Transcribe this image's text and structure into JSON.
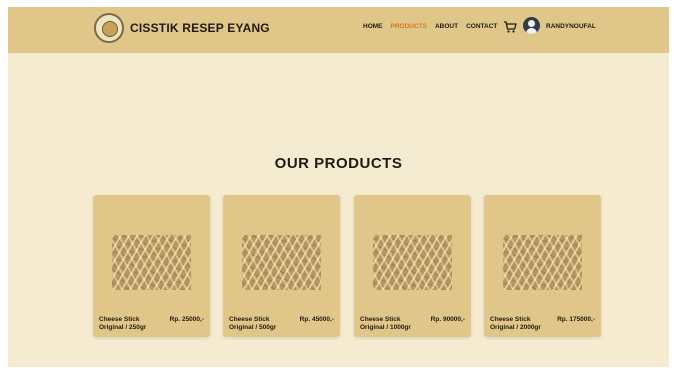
{
  "header": {
    "brand": "CISSTIK RESEP EYANG",
    "nav": [
      "HOME",
      "PRODUCTS",
      "ABOUT",
      "CONTACT"
    ],
    "active_nav": "PRODUCTS",
    "username": "RANDYNOUFAL",
    "icons": {
      "logo": "brand-logo",
      "cart": "cart-icon",
      "avatar": "user-avatar-icon"
    }
  },
  "main": {
    "title": "OUR PRODUCTS",
    "products": [
      {
        "name": "Cheese Stick\nOriginal / 250gr",
        "price": "Rp. 25000,-"
      },
      {
        "name": "Cheese Stick\nOriginal / 500gr",
        "price": "Rp. 45000,-"
      },
      {
        "name": "Cheese Stick\nOriginal / 1000gr",
        "price": "Rp. 90000,-"
      },
      {
        "name": "Cheese Stick\nOriginal / 2000gr",
        "price": "Rp. 175000,-"
      }
    ]
  },
  "colors": {
    "header_bg": "#e1c68a",
    "page_bg": "#f5ebd1",
    "active_link": "#d27a19",
    "card_bg": "#e1c68a"
  }
}
